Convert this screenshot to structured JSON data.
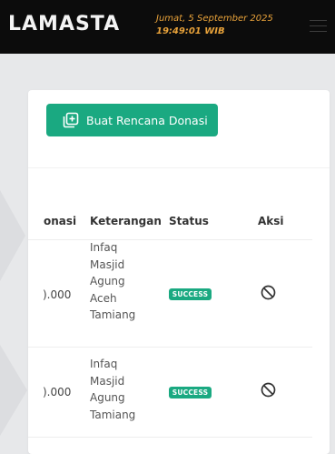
{
  "header": {
    "logo": "LAMASTA",
    "date": "Jumat, 5 September 2025",
    "time": "19:49:01 WIB",
    "menu_icon": "hamburger-menu-icon"
  },
  "card": {
    "create_button_label": "Buat Rencana Donasi",
    "create_button_icon": "add-square-icon"
  },
  "table": {
    "columns": [
      "onasi",
      "Keterangan",
      "Status",
      "Aksi"
    ],
    "rows": [
      {
        "amount": ").000",
        "description_lines": [
          "Infaq",
          "Masjid",
          "Agung",
          "Aceh",
          "Tamiang"
        ],
        "status": "SUCCESS",
        "action_icon": "cancel-icon"
      },
      {
        "amount": ").000",
        "description_lines": [
          "Infaq",
          "Masjid",
          "Agung",
          "Tamiang"
        ],
        "status": "SUCCESS",
        "action_icon": "cancel-icon"
      }
    ]
  },
  "colors": {
    "topbar_bg": "#0c0c0c",
    "accent_green": "#1aa981",
    "datetime_orange": "#e8a23a",
    "page_bg": "#e7e8ea"
  }
}
